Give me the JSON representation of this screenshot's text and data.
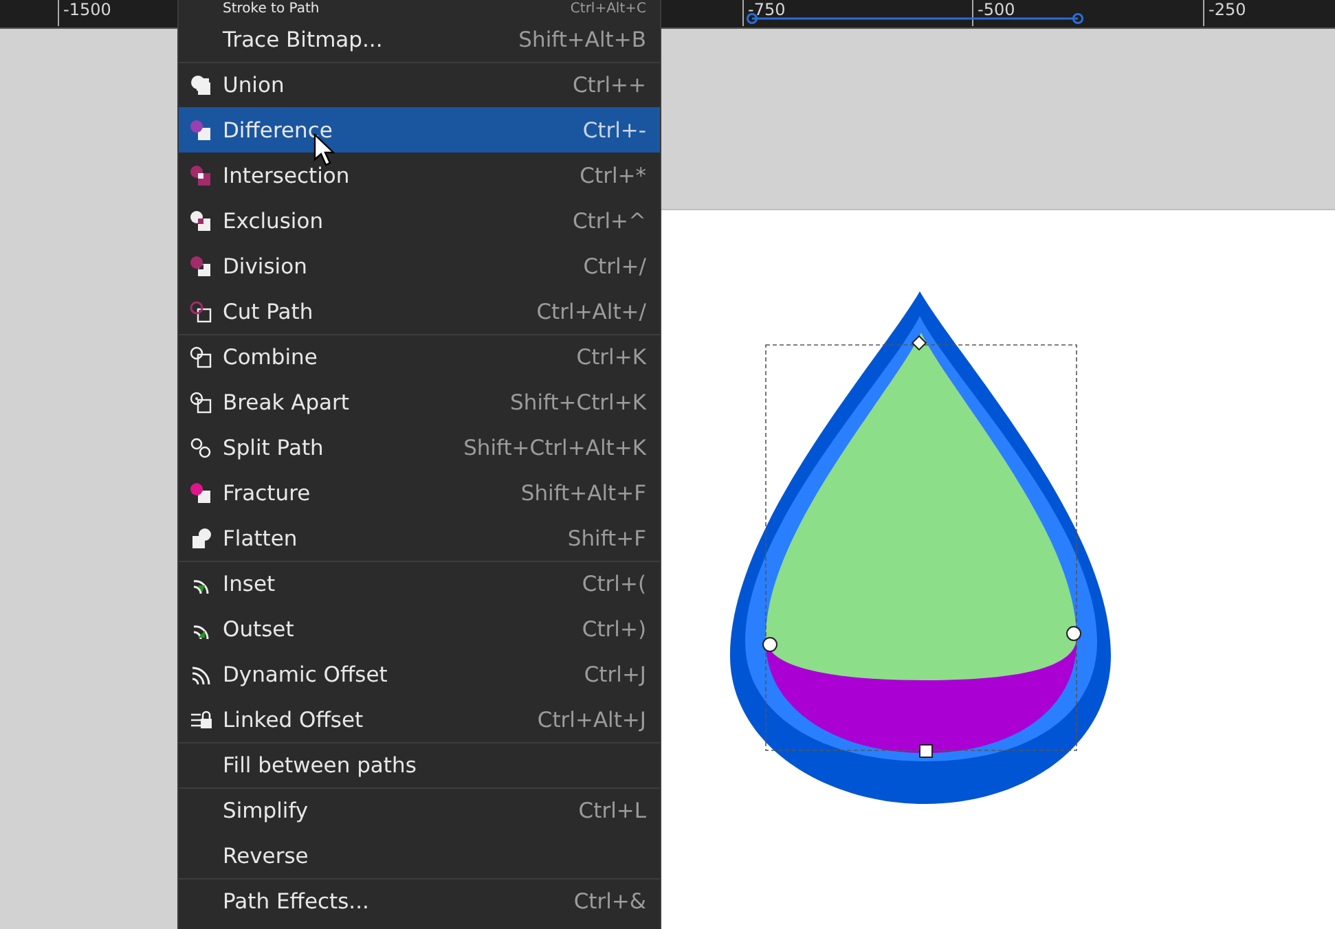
{
  "ruler": {
    "labels": [
      "-1500",
      "-750",
      "-500",
      "-250"
    ]
  },
  "menu": {
    "items": [
      {
        "label": "Stroke to Path",
        "shortcut": "Ctrl+Alt+C",
        "selected": false,
        "partial": true
      },
      {
        "label": "Trace Bitmap...",
        "shortcut": "Shift+Alt+B",
        "selected": false
      },
      {
        "label": "Union",
        "shortcut": "Ctrl++",
        "selected": false,
        "separator_before": true
      },
      {
        "label": "Difference",
        "shortcut": "Ctrl+-",
        "selected": true
      },
      {
        "label": "Intersection",
        "shortcut": "Ctrl+*",
        "selected": false
      },
      {
        "label": "Exclusion",
        "shortcut": "Ctrl+^",
        "selected": false
      },
      {
        "label": "Division",
        "shortcut": "Ctrl+/",
        "selected": false
      },
      {
        "label": "Cut Path",
        "shortcut": "Ctrl+Alt+/",
        "selected": false
      },
      {
        "label": "Combine",
        "shortcut": "Ctrl+K",
        "selected": false,
        "separator_before": true
      },
      {
        "label": "Break Apart",
        "shortcut": "Shift+Ctrl+K",
        "selected": false
      },
      {
        "label": "Split Path",
        "shortcut": "Shift+Ctrl+Alt+K",
        "selected": false
      },
      {
        "label": "Fracture",
        "shortcut": "Shift+Alt+F",
        "selected": false
      },
      {
        "label": "Flatten",
        "shortcut": "Shift+F",
        "selected": false
      },
      {
        "label": "Inset",
        "shortcut": "Ctrl+(",
        "selected": false,
        "separator_before": true
      },
      {
        "label": "Outset",
        "shortcut": "Ctrl+)",
        "selected": false
      },
      {
        "label": "Dynamic Offset",
        "shortcut": "Ctrl+J",
        "selected": false
      },
      {
        "label": "Linked Offset",
        "shortcut": "Ctrl+Alt+J",
        "selected": false
      },
      {
        "label": "Fill between paths",
        "selected": false,
        "separator_before": true
      },
      {
        "label": "Simplify",
        "shortcut": "Ctrl+L",
        "selected": false,
        "separator_before": true
      },
      {
        "label": "Reverse",
        "selected": false
      },
      {
        "label": "Path Effects...",
        "shortcut": "Ctrl+&",
        "selected": false,
        "separator_before": true
      }
    ]
  }
}
